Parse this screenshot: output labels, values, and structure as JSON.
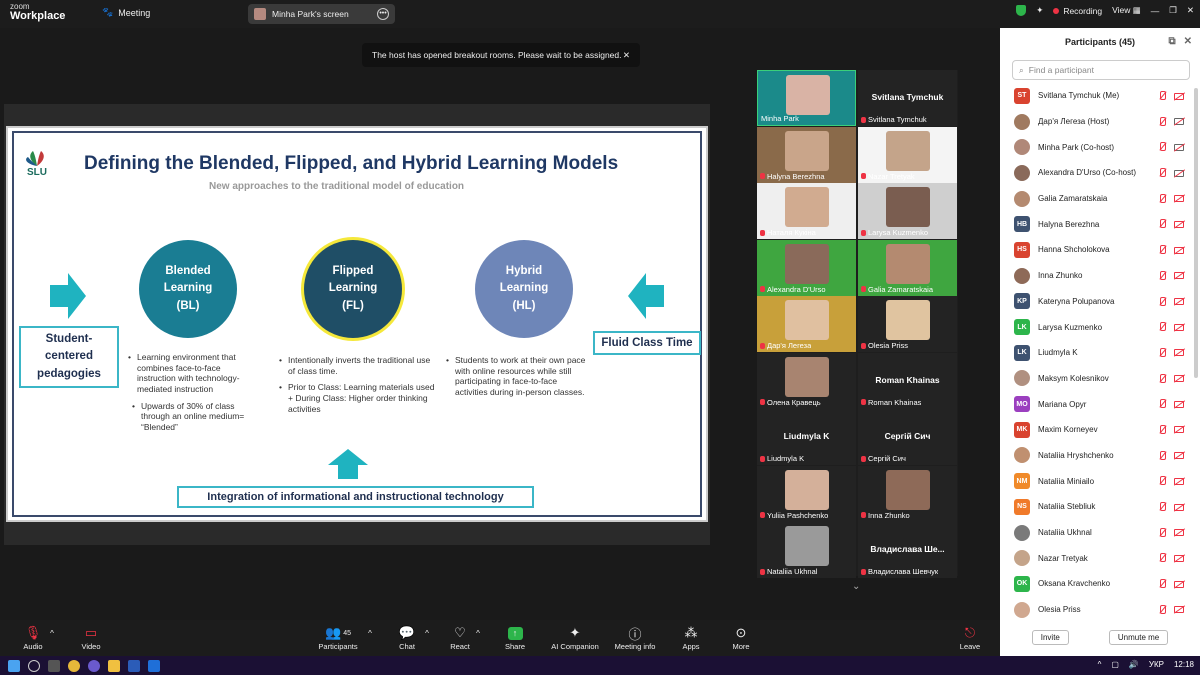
{
  "app": {
    "logo_line1": "zoom",
    "logo_line2": "Workplace",
    "meeting_tab": "Meeting",
    "shared_screen": "Minha Park's screen"
  },
  "topbar": {
    "recording": "Recording",
    "view": "View"
  },
  "toast": {
    "message": "The host has opened breakout rooms. Please wait to be assigned.",
    "close": "✕"
  },
  "slide": {
    "logo_text": "SLU",
    "title": "Defining the Blended, Flipped, and Hybrid Learning Models",
    "subtitle": "New approaches to the traditional model of education",
    "circles": [
      {
        "l1": "Blended",
        "l2": "Learning",
        "l3": "(BL)",
        "color": "#1a7d93"
      },
      {
        "l1": "Flipped",
        "l2": "Learning",
        "l3": "(FL)",
        "color": "#1f4e66",
        "ring": "#f5e83a"
      },
      {
        "l1": "Hybrid",
        "l2": "Learning",
        "l3": "(HL)",
        "color": "#6e86b8"
      }
    ],
    "left_box": {
      "l1": "Student-",
      "l2": "centered",
      "l3": "pedagogies"
    },
    "right_box": "Fluid Class Time",
    "bottom_box": "Integration of informational and instructional technology",
    "bl_bullets": [
      "Learning environment that combines face-to-face instruction with technology-mediated instruction",
      "Upwards of 30% of class through an online medium= “Blended”"
    ],
    "fl_bullets": [
      "Intentionally inverts the traditional use of class time.",
      "Prior to Class: Learning materials used + During Class: Higher order thinking activities"
    ],
    "hl_bullets": [
      "Students to work at their own pace with online resources while still participating in face-to-face activities during in-person classes."
    ]
  },
  "gallery": [
    {
      "name": "Minha Park",
      "big": "",
      "bg": "#1b8a8a",
      "face": "#d9b3a5",
      "mic": false
    },
    {
      "name": "Svitlana Tymchuk",
      "big": "Svitlana Tymchuk",
      "bg": "#232323",
      "face": "",
      "mic": true
    },
    {
      "name": "Halyna Berezhna",
      "big": "",
      "bg": "#8a6a4a",
      "face": "#c9a58a",
      "mic": true
    },
    {
      "name": "Nazar Tretyak",
      "big": "",
      "bg": "#f4f4f4",
      "face": "#c4a48a",
      "mic": true
    },
    {
      "name": "Наталя Кукіна",
      "big": "",
      "bg": "#efefef",
      "face": "#d1ab90",
      "mic": true
    },
    {
      "name": "Larysa Kuzmenko",
      "big": "",
      "bg": "#cfcfcf",
      "face": "#7a5d50",
      "mic": true
    },
    {
      "name": "Alexandra D'Urso",
      "big": "",
      "bg": "#3fa640",
      "face": "#8a6a5a",
      "mic": true
    },
    {
      "name": "Galia Zamaratskaia",
      "big": "",
      "bg": "#3fa640",
      "face": "#b48a70",
      "mic": true
    },
    {
      "name": "Дар'я Легеза",
      "big": "",
      "bg": "#c8a03a",
      "face": "#e0c0a0",
      "mic": true
    },
    {
      "name": "Olesia Priss",
      "big": "",
      "bg": "#232323",
      "face": "#e0c4a0",
      "mic": true
    },
    {
      "name": "Олена Кравець",
      "big": "",
      "bg": "#232323",
      "face": "#a88470",
      "mic": true
    },
    {
      "name": "Roman Khainas",
      "big": "Roman Khainas",
      "bg": "#232323",
      "face": "",
      "mic": true
    },
    {
      "name": "Liudmyla K",
      "big": "Liudmyla K",
      "bg": "#232323",
      "face": "",
      "mic": true
    },
    {
      "name": "Сергій Сич",
      "big": "Сергій Сич",
      "bg": "#232323",
      "face": "",
      "mic": true
    },
    {
      "name": "Yuliia Pashchenko",
      "big": "",
      "bg": "#232323",
      "face": "#d4b09a",
      "mic": true
    },
    {
      "name": "Inna Zhunko",
      "big": "",
      "bg": "#232323",
      "face": "#8e6a58",
      "mic": true
    },
    {
      "name": "Nataliia Ukhnal",
      "big": "",
      "bg": "#232323",
      "face": "#9a9a9a",
      "mic": true
    },
    {
      "name": "Владислава Шевчук",
      "big": "Владислава Ше...",
      "bg": "#232323",
      "face": "",
      "mic": true
    }
  ],
  "panel": {
    "title": "Participants (45)",
    "search_placeholder": "Find a participant",
    "invite": "Invite",
    "unmute_me": "Unmute me",
    "participants": [
      {
        "initials": "ST",
        "name": "Svitlana Tymchuk (Me)",
        "color": "#d9432f",
        "photo": false,
        "cam": false
      },
      {
        "initials": "",
        "name": "Дар'я Легеза (Host)",
        "color": "#a07a60",
        "photo": true,
        "cam": true
      },
      {
        "initials": "",
        "name": "Minha Park (Co-host)",
        "color": "#b08878",
        "photo": true,
        "cam": true
      },
      {
        "initials": "",
        "name": "Alexandra D'Urso (Co-host)",
        "color": "#8a6a5a",
        "photo": true,
        "cam": true
      },
      {
        "initials": "",
        "name": "Galia Zamaratskaia",
        "color": "#b48a70",
        "photo": true,
        "cam": false
      },
      {
        "initials": "HB",
        "name": "Halyna Berezhna",
        "color": "#3e5270",
        "photo": false,
        "cam": false
      },
      {
        "initials": "HS",
        "name": "Hanna Shcholokova",
        "color": "#d9432f",
        "photo": false,
        "cam": false
      },
      {
        "initials": "",
        "name": "Inna Zhunko",
        "color": "#8e6a58",
        "photo": true,
        "cam": false
      },
      {
        "initials": "KP",
        "name": "Kateryna Polupanova",
        "color": "#3e5270",
        "photo": false,
        "cam": false
      },
      {
        "initials": "LK",
        "name": "Larysa Kuzmenko",
        "color": "#2db54b",
        "photo": false,
        "cam": false
      },
      {
        "initials": "LK",
        "name": "Liudmyla K",
        "color": "#3e5270",
        "photo": false,
        "cam": false
      },
      {
        "initials": "",
        "name": "Maksym Kolesnikov",
        "color": "#b09080",
        "photo": true,
        "cam": false
      },
      {
        "initials": "MO",
        "name": "Mariana Opyr",
        "color": "#9b3fbf",
        "photo": false,
        "cam": false
      },
      {
        "initials": "MK",
        "name": "Maxim Korneyev",
        "color": "#d9432f",
        "photo": false,
        "cam": false
      },
      {
        "initials": "",
        "name": "Nataliia Hryshchenko",
        "color": "#c09070",
        "photo": true,
        "cam": false
      },
      {
        "initials": "NM",
        "name": "Nataliia Miniailo",
        "color": "#f08a2a",
        "photo": false,
        "cam": false
      },
      {
        "initials": "NS",
        "name": "Nataliia Stebliuk",
        "color": "#f07a2a",
        "photo": false,
        "cam": false
      },
      {
        "initials": "",
        "name": "Nataliia Ukhnal",
        "color": "#7a7a7a",
        "photo": true,
        "cam": false
      },
      {
        "initials": "",
        "name": "Nazar Tretyak",
        "color": "#c4a48a",
        "photo": true,
        "cam": false
      },
      {
        "initials": "OK",
        "name": "Oksana Kravchenko",
        "color": "#2db54b",
        "photo": false,
        "cam": false
      },
      {
        "initials": "",
        "name": "Olesia Priss",
        "color": "#d0a890",
        "photo": true,
        "cam": false
      }
    ]
  },
  "toolbar": {
    "audio": "Audio",
    "video": "Video",
    "participants": "Participants",
    "participants_count": "45",
    "chat": "Chat",
    "react": "React",
    "share": "Share",
    "ai": "AI Companion",
    "info": "Meeting info",
    "apps": "Apps",
    "more": "More",
    "leave": "Leave"
  },
  "taskbar": {
    "lang": "УКР",
    "time": "12:18"
  }
}
